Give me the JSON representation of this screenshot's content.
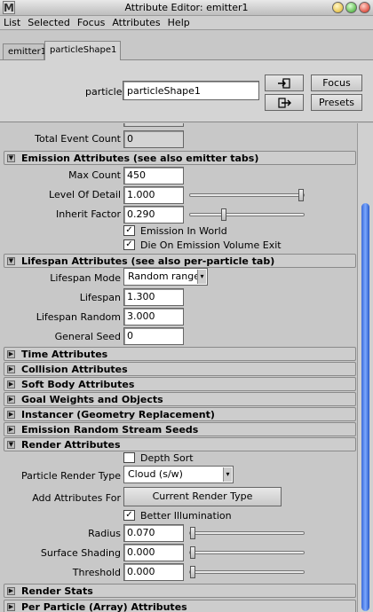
{
  "window": {
    "title": "Attribute Editor: emitter1",
    "app_icon": "M"
  },
  "menu": [
    "List",
    "Selected",
    "Focus",
    "Attributes",
    "Help"
  ],
  "tabs": [
    "emitter1",
    "particleShape1"
  ],
  "header": {
    "particle_label": "particle:",
    "particle_value": "particleShape1",
    "focus_label": "Focus",
    "presets_label": "Presets"
  },
  "top": {
    "total_event_count_label": "Total Event Count",
    "total_event_count_value": "0"
  },
  "emission": {
    "title": "Emission Attributes (see also emitter tabs)",
    "max_count_label": "Max Count",
    "max_count": "450",
    "lod_label": "Level Of Detail",
    "lod": "1.000",
    "lod_slider": 1.0,
    "inherit_label": "Inherit Factor",
    "inherit": "0.290",
    "inherit_slider": 0.29,
    "emission_in_world": "Emission In World",
    "die_on_volume_exit": "Die On Emission Volume Exit",
    "emission_in_world_checked": true,
    "die_on_volume_exit_checked": true
  },
  "lifespan": {
    "title": "Lifespan Attributes (see also per-particle tab)",
    "mode_label": "Lifespan Mode",
    "mode": "Random range",
    "lifespan_label": "Lifespan",
    "lifespan": "1.300",
    "random_label": "Lifespan Random",
    "random": "3.000",
    "seed_label": "General Seed",
    "seed": "0"
  },
  "collapsed_sections": [
    "Time Attributes",
    "Collision Attributes",
    "Soft Body Attributes",
    "Goal Weights and Objects",
    "Instancer (Geometry Replacement)",
    "Emission Random Stream Seeds"
  ],
  "render": {
    "title": "Render Attributes",
    "depth_sort": "Depth Sort",
    "depth_sort_checked": false,
    "type_label": "Particle Render Type",
    "type": "Cloud (s/w)",
    "add_attrs_label": "Add Attributes For",
    "add_attrs_button": "Current Render Type",
    "better_illum": "Better Illumination",
    "better_illum_checked": true,
    "radius_label": "Radius",
    "radius": "0.070",
    "radius_slider": 0.0,
    "surface_label": "Surface Shading",
    "surface": "0.000",
    "surface_slider": 0.0,
    "threshold_label": "Threshold",
    "threshold": "0.000",
    "threshold_slider": 0.0
  },
  "bottom_sections": [
    "Render Stats",
    "Per Particle (Array) Attributes"
  ]
}
